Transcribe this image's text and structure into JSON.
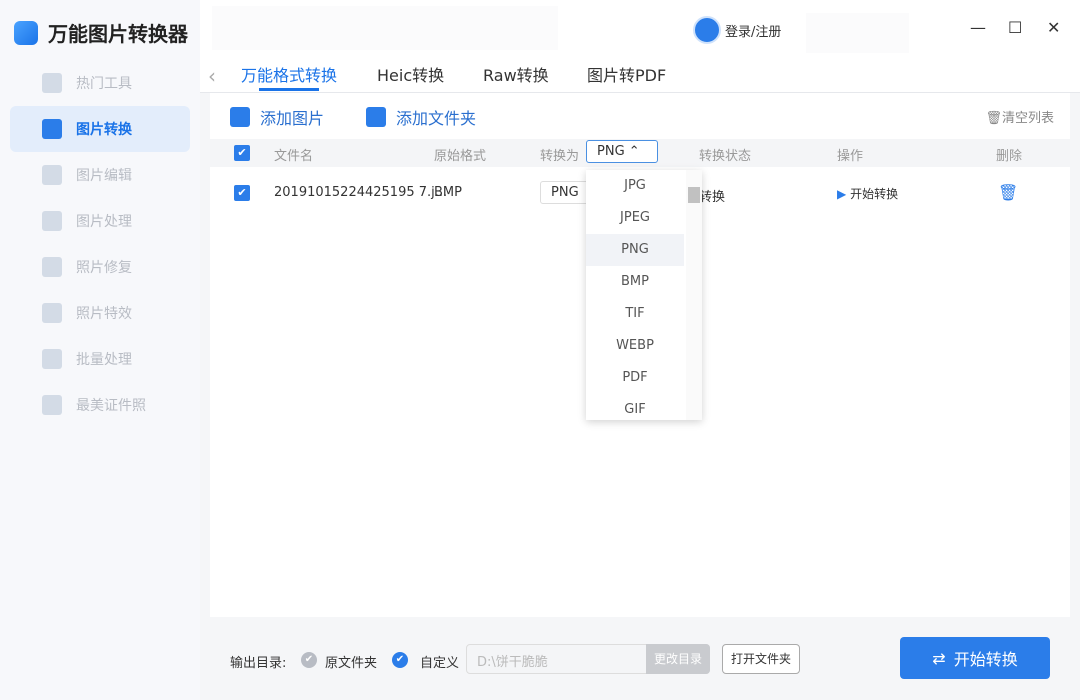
{
  "app": {
    "title": "万能图片转换器"
  },
  "sidebar": {
    "items": [
      {
        "label": "热门工具"
      },
      {
        "label": "图片转换"
      },
      {
        "label": "图片编辑"
      },
      {
        "label": "图片处理"
      },
      {
        "label": "照片修复"
      },
      {
        "label": "照片特效"
      },
      {
        "label": "批量处理"
      },
      {
        "label": "最美证件照"
      }
    ]
  },
  "header": {
    "login": "登录/注册",
    "minimize": "—",
    "maximize": "☐",
    "close": "✕"
  },
  "tabs": [
    {
      "label": "万能格式转换"
    },
    {
      "label": "Heic转换"
    },
    {
      "label": "Raw转换"
    },
    {
      "label": "图片转PDF"
    }
  ],
  "toolbar": {
    "add_image": "添加图片",
    "add_folder": "添加文件夹",
    "clear": "清空列表"
  },
  "table": {
    "headers": {
      "filename": "文件名",
      "original": "原始格式",
      "convert_to": "转换为",
      "convert_to_value": "PNG",
      "status": "转换状态",
      "action": "操作",
      "delete": "删除"
    },
    "rows": [
      {
        "filename": "20191015224425195 7.j...",
        "original": "BMP",
        "target": "PNG",
        "status": "待转换",
        "action": "开始转换"
      }
    ]
  },
  "dropdown": {
    "options": [
      "JPG",
      "JPEG",
      "PNG",
      "BMP",
      "TIF",
      "WEBP",
      "PDF",
      "GIF"
    ],
    "selected": "PNG"
  },
  "bottom": {
    "output_label": "输出目录:",
    "original_folder": "原文件夹",
    "custom": "自定义",
    "path_placeholder": "D:\\饼干脆脆",
    "change_dir": "更改目录",
    "open_folder": "打开文件夹",
    "start": "开始转换"
  }
}
